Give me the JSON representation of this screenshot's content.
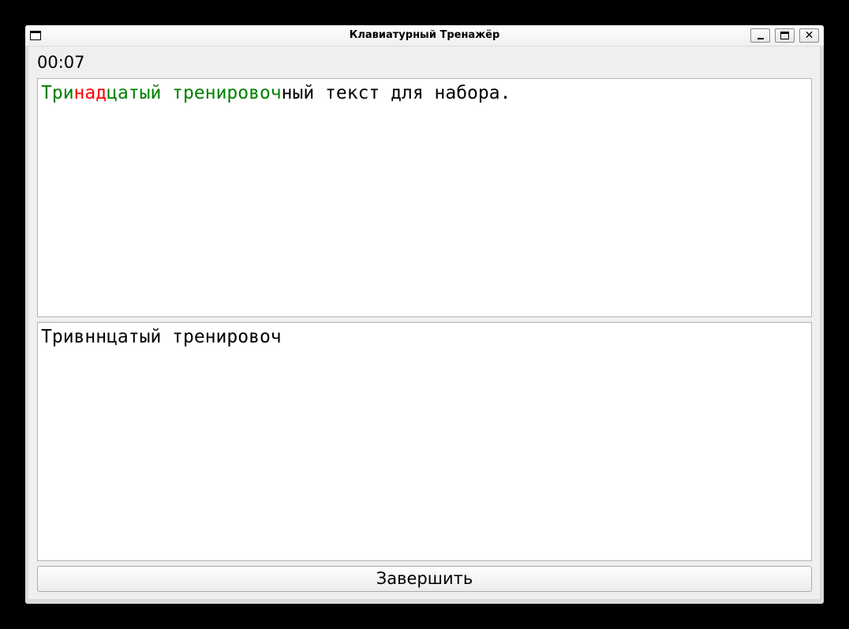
{
  "window": {
    "title": "Клавиатурный Тренажёр",
    "controls": {
      "minimize_icon": "minimize-icon",
      "maximize_icon": "maximize-icon",
      "close_icon": "close-icon",
      "close_glyph": "✕"
    }
  },
  "timer": {
    "value": "00:07"
  },
  "source_text": {
    "segments": [
      {
        "text": "Три",
        "status": "correct"
      },
      {
        "text": "над",
        "status": "wrong"
      },
      {
        "text": "цатый тренировоч",
        "status": "correct"
      },
      {
        "text": "ный текст для набора.",
        "status": "pending"
      }
    ]
  },
  "typed_text": {
    "value": "Тривннцатый тренировоч"
  },
  "finish_button": {
    "label": "Завершить"
  },
  "colors": {
    "correct": "#008000",
    "wrong": "#ff0000",
    "pending": "#000000",
    "desktop_background": "#000000"
  }
}
